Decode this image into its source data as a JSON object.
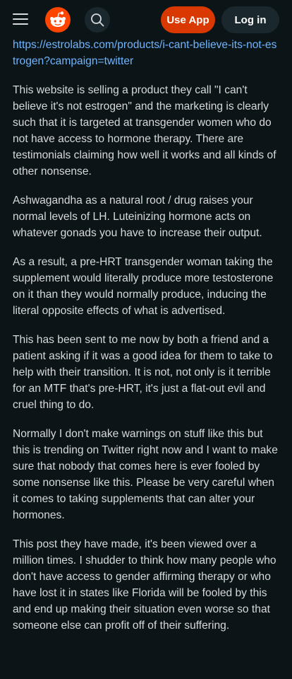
{
  "header": {
    "logo_icon": "reddit-alien-icon",
    "menu_icon": "hamburger-menu-icon",
    "search_icon": "search-icon",
    "use_app_label": "Use App",
    "login_label": "Log in",
    "brand_color": "#ff4500",
    "use_app_color": "#d93900"
  },
  "post": {
    "link_text": "https://estrolabs.com/products/i-cant-believe-its-not-estrogen?campaign=twitter",
    "paragraphs": [
      "This website is selling a product they call \"I can't believe it's not estrogen\" and the marketing is clearly such that it is targeted at transgender women who do not have access to hormone therapy. There are testimonials claiming how well it works and all kinds of other nonsense.",
      "Ashwagandha as a natural root / drug raises your normal levels of LH. Luteinizing hormone acts on whatever gonads you have to increase their output.",
      "As a result, a pre-HRT transgender woman taking the supplement would literally produce more testosterone on it than they would normally produce, inducing the literal opposite effects of what is advertised.",
      "This has been sent to me now by both a friend and a patient asking if it was a good idea for them to take to help with their transition. It is not, not only is it terrible for an MTF that's pre-HRT, it's just a flat-out evil and cruel thing to do.",
      "Normally I don't make warnings on stuff like this but this is trending on Twitter right now and I want to make sure that nobody that comes here is ever fooled by some nonsense like this. Please be very careful when it comes to taking supplements that can alter your hormones.",
      "This post they have made, it's been viewed over a million times. I shudder to think how many people who don't have access to gender affirming therapy or who have lost it in states like Florida will be fooled by this and end up making their situation even worse so that someone else can profit off of their suffering."
    ]
  },
  "colors": {
    "background": "#0b1416",
    "text": "#d7dadc",
    "link": "#6fb5ff",
    "button_dark": "#1a282d"
  }
}
